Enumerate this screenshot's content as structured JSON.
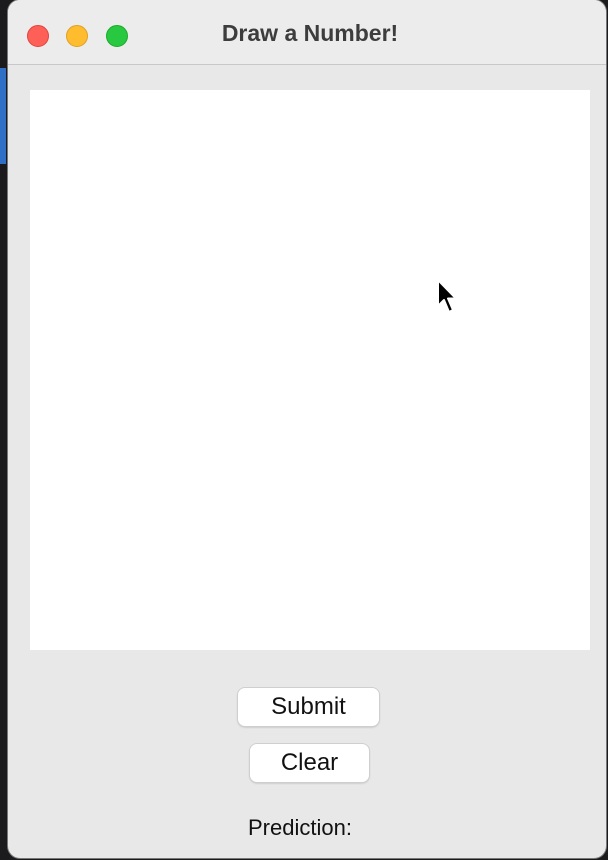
{
  "window": {
    "title": "Draw a Number!"
  },
  "controls": {
    "close_icon": "close-traffic-light",
    "minimize_icon": "minimize-traffic-light",
    "maximize_icon": "maximize-traffic-light",
    "colors": {
      "close": "#fe5f57",
      "minimize": "#febc2e",
      "maximize": "#28c840"
    }
  },
  "canvas": {
    "background": "#ffffff"
  },
  "buttons": {
    "submit_label": "Submit",
    "clear_label": "Clear"
  },
  "prediction": {
    "label": "Prediction:",
    "value": ""
  }
}
